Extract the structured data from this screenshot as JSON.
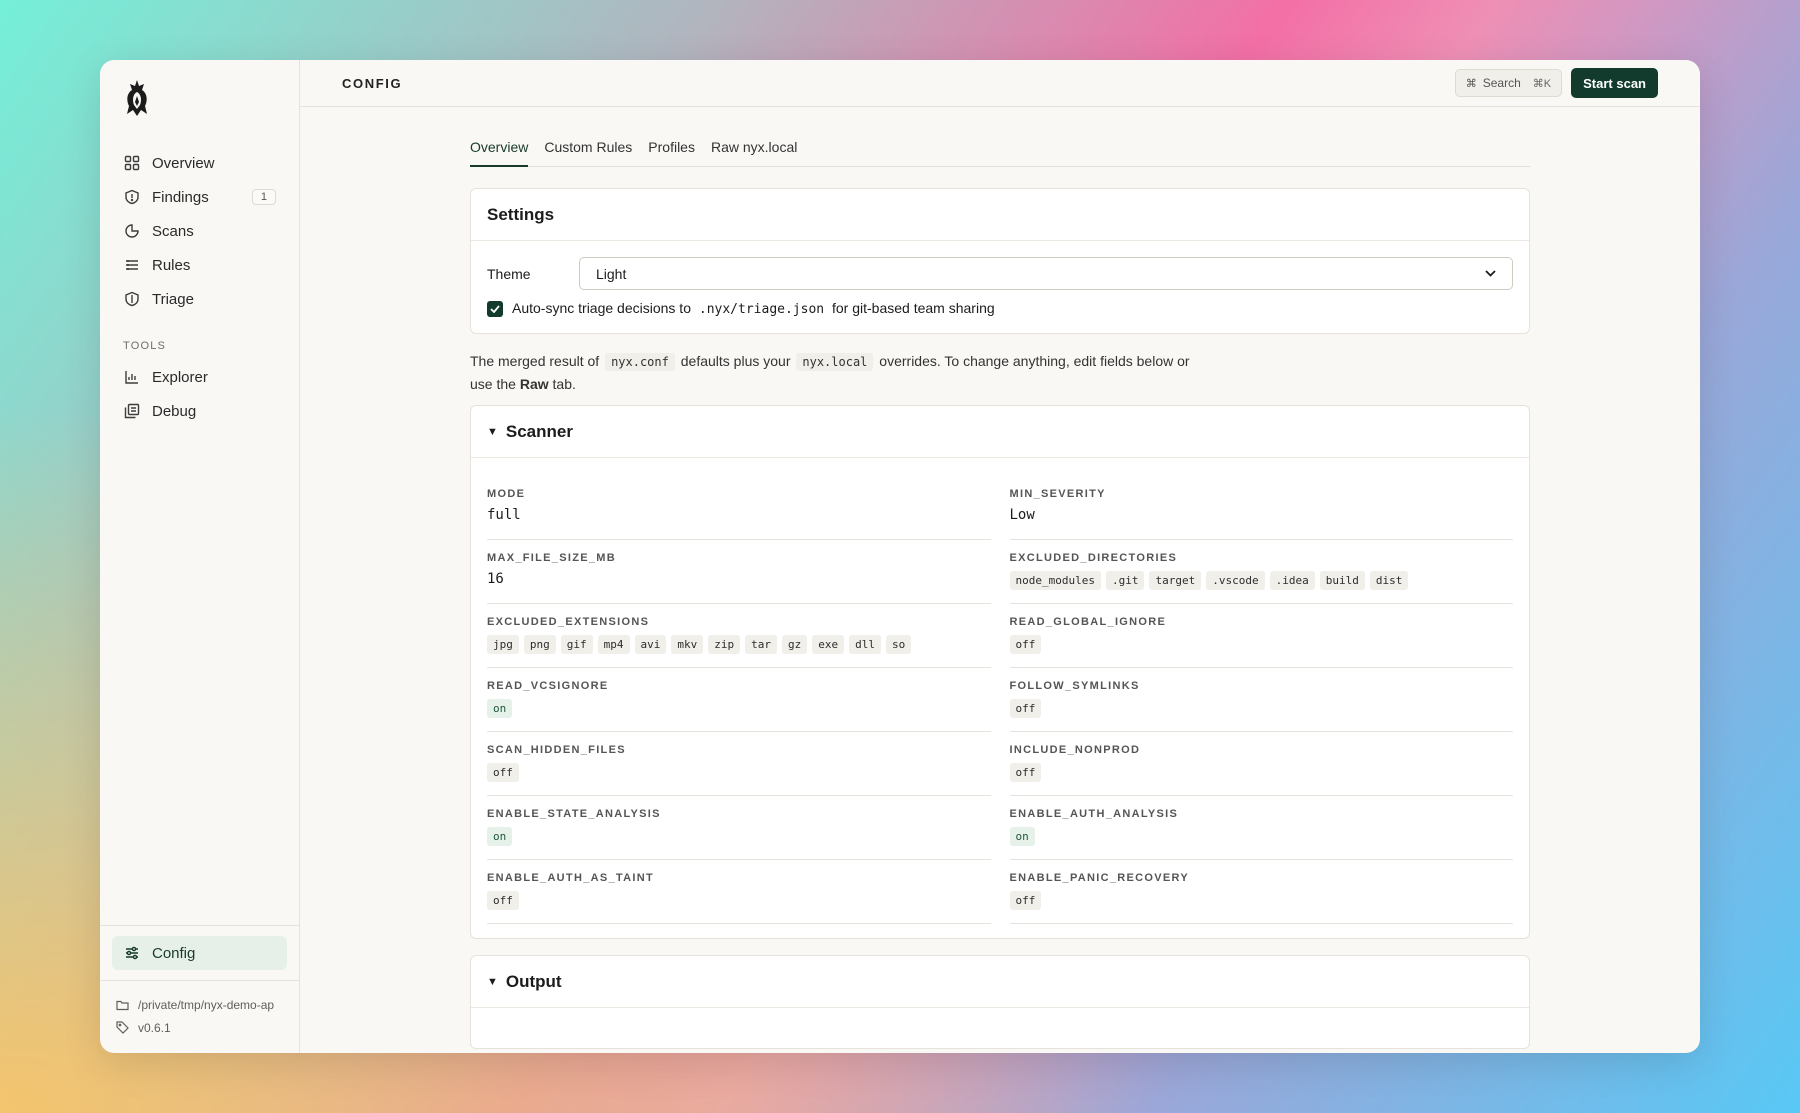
{
  "sidebar": {
    "nav": [
      {
        "label": "Overview",
        "icon": "grid-icon"
      },
      {
        "label": "Findings",
        "icon": "shield-alert-icon",
        "badge": "1"
      },
      {
        "label": "Scans",
        "icon": "pie-icon"
      },
      {
        "label": "Rules",
        "icon": "list-icon"
      },
      {
        "label": "Triage",
        "icon": "shield-icon"
      }
    ],
    "tools_label": "TOOLS",
    "tools": [
      {
        "label": "Explorer",
        "icon": "chart-icon"
      },
      {
        "label": "Debug",
        "icon": "copy-icon"
      }
    ],
    "config_label": "Config",
    "path": "/private/tmp/nyx-demo-ap",
    "version": "v0.6.1"
  },
  "header": {
    "title": "CONFIG",
    "search_label": "Search",
    "search_kbd": "⌘K",
    "start_label": "Start scan"
  },
  "tabs": [
    "Overview",
    "Custom Rules",
    "Profiles",
    "Raw nyx.local"
  ],
  "settings": {
    "title": "Settings",
    "theme_label": "Theme",
    "theme_value": "Light",
    "autosync_before": "Auto-sync triage decisions to",
    "autosync_code": ".nyx/triage.json",
    "autosync_after": "for git-based team sharing"
  },
  "description": {
    "p1": "The merged result of",
    "c1": "nyx.conf",
    "p2": "defaults plus your",
    "c2": "nyx.local",
    "p3": "overrides. To change anything, edit fields below or use the",
    "bold": "Raw",
    "p4": "tab."
  },
  "scanner": {
    "title": "Scanner",
    "mode_key": "MODE",
    "mode_val": "full",
    "minsev_key": "MIN_SEVERITY",
    "minsev_val": "Low",
    "maxsize_key": "MAX_FILE_SIZE_MB",
    "maxsize_val": "16",
    "exdirs_key": "EXCLUDED_DIRECTORIES",
    "exdirs": [
      "node_modules",
      ".git",
      "target",
      ".vscode",
      ".idea",
      "build",
      "dist"
    ],
    "exext_key": "EXCLUDED_EXTENSIONS",
    "exext": [
      "jpg",
      "png",
      "gif",
      "mp4",
      "avi",
      "mkv",
      "zip",
      "tar",
      "gz",
      "exe",
      "dll",
      "so"
    ],
    "rgi_key": "READ_GLOBAL_IGNORE",
    "rgi_val": "off",
    "rvcs_key": "READ_VCSIGNORE",
    "rvcs_val": "on",
    "fsym_key": "FOLLOW_SYMLINKS",
    "fsym_val": "off",
    "shf_key": "SCAN_HIDDEN_FILES",
    "shf_val": "off",
    "inp_key": "INCLUDE_NONPROD",
    "inp_val": "off",
    "esa_key": "ENABLE_STATE_ANALYSIS",
    "esa_val": "on",
    "eaa_key": "ENABLE_AUTH_ANALYSIS",
    "eaa_val": "on",
    "eat_key": "ENABLE_AUTH_AS_TAINT",
    "eat_val": "off",
    "epr_key": "ENABLE_PANIC_RECOVERY",
    "epr_val": "off"
  },
  "output": {
    "title": "Output"
  },
  "colors": {
    "accent": "#123b2d",
    "active_bg": "#e7efe9"
  }
}
